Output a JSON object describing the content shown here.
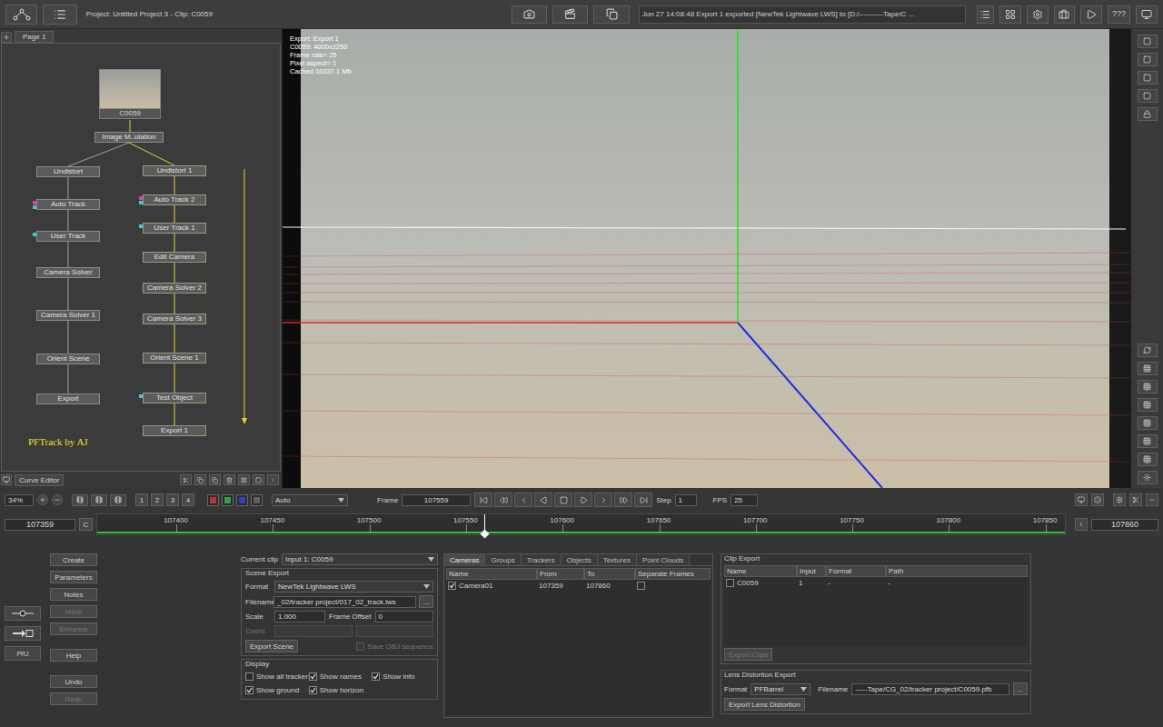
{
  "window": {
    "title": "Project: Untitled Project 3 - Clip: C0059"
  },
  "status": "Jun 27 14:08:48 Export 1 exported [NewTek Lightwave LWS] to [D:/----------Tape/C ...",
  "help_button": "???",
  "node_graph": {
    "page_tab": "Page 1",
    "clip_node": "C0059",
    "root_node": "Image M..ulation",
    "credit": "PFTrack by AJ",
    "columns": [
      {
        "active": false,
        "nodes": [
          {
            "label": "Undistort",
            "markers": []
          },
          {
            "label": "Auto Track",
            "markers": [
              "#e040a0",
              "#40c8d8"
            ]
          },
          {
            "label": "User Track",
            "markers": [
              "#40c8d8"
            ]
          },
          {
            "label": "Camera Solver",
            "markers": []
          },
          {
            "label": "Camera Solver 1",
            "markers": []
          },
          {
            "label": "Orient Scene",
            "markers": []
          },
          {
            "label": "Export",
            "markers": []
          }
        ]
      },
      {
        "active": true,
        "nodes": [
          {
            "label": "Undistort 1",
            "markers": []
          },
          {
            "label": "Auto Track 2",
            "markers": [
              "#e040a0",
              "#40c8d8"
            ]
          },
          {
            "label": "User Track 1",
            "markers": [
              "#40c8d8"
            ]
          },
          {
            "label": "Edit Camera",
            "markers": []
          },
          {
            "label": "Camera Solver 2",
            "markers": []
          },
          {
            "label": "Camera Solver 3",
            "markers": []
          },
          {
            "label": "Orient Scene 1",
            "markers": []
          },
          {
            "label": "Test Object",
            "markers": [
              "#40c8d8"
            ]
          },
          {
            "label": "Export 1",
            "markers": []
          }
        ]
      }
    ]
  },
  "curve_editor_tab": "Curve Editor",
  "viewer": {
    "info": [
      "Export: Export 1",
      "C0059: 4000x2250",
      "Frame rate= 25",
      "Pixel aspect= 1",
      "Cached 16337.1 Mb"
    ]
  },
  "transport": {
    "zoom": "34%",
    "views": [
      "1",
      "2",
      "3",
      "4"
    ],
    "channels": [
      {
        "color": "#c03030"
      },
      {
        "color": "#30a040"
      },
      {
        "color": "#3040c0"
      },
      {
        "color": "#606060"
      }
    ],
    "mode": "Auto",
    "frame_label": "Frame",
    "frame": "107559",
    "step_label": "Step",
    "step": "1",
    "fps_label": "FPS",
    "fps": "25"
  },
  "timeline": {
    "start": "107359",
    "cache_button": "C",
    "end": "107860",
    "level": 0.4,
    "ticks": [
      "107400",
      "107450",
      "107500",
      "107550",
      "107600",
      "107650",
      "107700",
      "107750",
      "107800",
      "107850"
    ]
  },
  "project_button": "PRJ",
  "side_buttons": [
    {
      "label": "Create",
      "disabled": false,
      "selected": false
    },
    {
      "label": "Parameters",
      "disabled": false,
      "selected": true
    },
    {
      "label": "Notes",
      "disabled": false,
      "selected": false
    },
    {
      "label": "Mask",
      "disabled": true,
      "selected": false
    },
    {
      "label": "Enhance",
      "disabled": true,
      "selected": false
    },
    {
      "label": "Help",
      "disabled": false,
      "selected": false
    },
    {
      "label": "Undo",
      "disabled": false,
      "selected": false
    },
    {
      "label": "Redo",
      "disabled": true,
      "selected": false
    }
  ],
  "scene_export": {
    "current_clip_label": "Current clip",
    "current_clip": "Input 1: C0059",
    "title": "Scene Export",
    "format_label": "Format",
    "format": "NewTek Lightwave LWS",
    "filename_label": "Filename",
    "filename": "_02/tracker project/017_02_track.lws",
    "browse": "...",
    "scale_label": "Scale",
    "scale": "1.000",
    "offset_label": "Frame Offset",
    "offset": "0",
    "coord_label": "Coord",
    "export_button": "Export Scene",
    "obj_sequence": {
      "label": "Save OBJ sequence",
      "checked": false,
      "disabled": true
    }
  },
  "display": {
    "title": "Display",
    "options": [
      {
        "label": "Show all trackers",
        "checked": false
      },
      {
        "label": "Show names",
        "checked": true
      },
      {
        "label": "Show info",
        "checked": true
      },
      {
        "label": "Show ground",
        "checked": true
      },
      {
        "label": "Show horizon",
        "checked": true
      }
    ]
  },
  "tabs": [
    {
      "label": "Cameras",
      "selected": true
    },
    {
      "label": "Groups",
      "selected": false
    },
    {
      "label": "Trackers",
      "selected": false
    },
    {
      "label": "Objects",
      "selected": false
    },
    {
      "label": "Textures",
      "selected": false
    },
    {
      "label": "Point Clouds",
      "selected": false
    }
  ],
  "cameras": {
    "columns": [
      "Name",
      "From",
      "To",
      "Separate Frames"
    ],
    "rows": [
      {
        "checked": true,
        "name": "Camera01",
        "from": "107359",
        "to": "107860",
        "separate": false
      }
    ]
  },
  "clip_export": {
    "title": "Clip Export",
    "columns": [
      "Name",
      "Input",
      "Format",
      "Path"
    ],
    "rows": [
      {
        "checked": false,
        "name": "C0059",
        "input": "1",
        "format": "-",
        "path": "-"
      }
    ],
    "export_button": "Export Clips",
    "export_disabled": true
  },
  "lens_export": {
    "title": "Lens Distortion Export",
    "format_label": "Format",
    "format": "PFBarrel",
    "filename_label": "Filename",
    "filename": "-----Tape/CG_02/tracker project/C0059.pfb",
    "browse": "...",
    "export_button": "Export Lens Distortion"
  }
}
